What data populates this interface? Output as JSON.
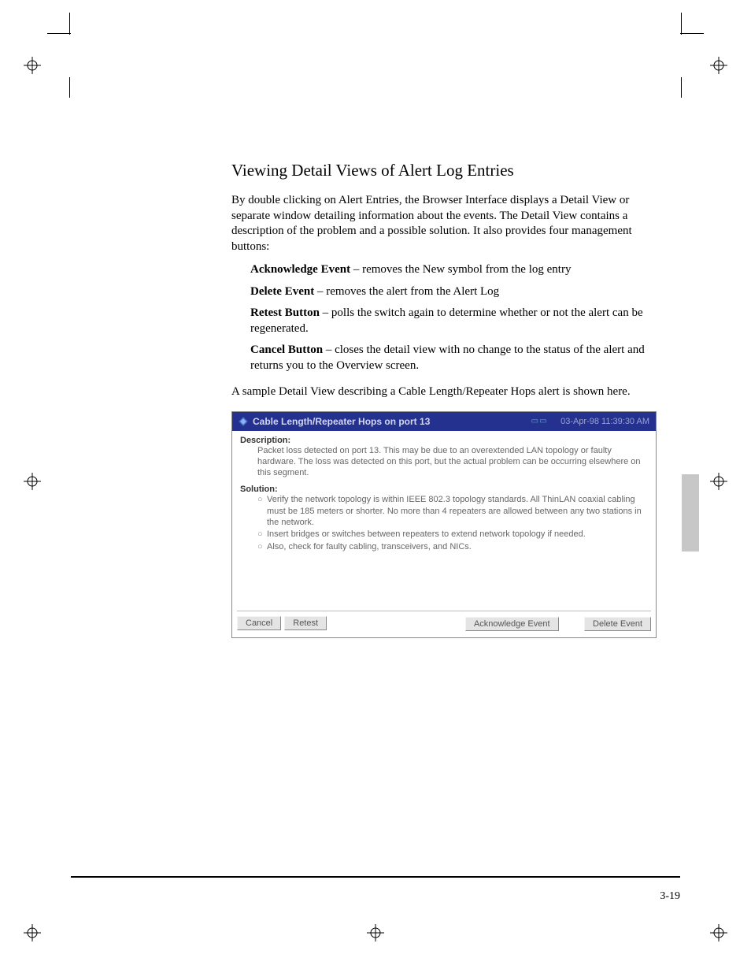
{
  "heading": "Viewing Detail Views of Alert Log Entries",
  "intro": "By double clicking on Alert Entries, the Browser Interface displays a Detail View or separate window detailing information about the events. The Detail View contains a description of the problem and a possible solution. It also provides four management buttons:",
  "buttons_desc": [
    {
      "label": "Acknowledge Event",
      "text": " – removes the New symbol from the log entry"
    },
    {
      "label": "Delete Event",
      "text": " – removes the alert from the Alert Log"
    },
    {
      "label": "Retest Button",
      "text": " – polls the switch again to determine whether or not the alert can be regenerated."
    },
    {
      "label": "Cancel Button",
      "text": " – closes the detail view with no change to the status of the alert and returns you to the Overview screen."
    }
  ],
  "sample_text": "A sample Detail View describing a Cable Length/Repeater Hops alert is shown here.",
  "detail": {
    "title": "Cable Length/Repeater Hops on port 13",
    "timestamp": "03-Apr-98 11:39:30 AM",
    "desc_label": "Description:",
    "description": "Packet loss detected on port 13. This may be due to an overextended LAN topology or faulty hardware. The loss was detected on this port, but the actual problem can be occurring elsewhere on this segment.",
    "sol_label": "Solution:",
    "solutions": [
      "Verify the network topology is within IEEE 802.3 topology standards. All ThinLAN coaxial cabling must be 185 meters or shorter. No more than 4 repeaters are allowed between any two stations in the network.",
      "Insert bridges or switches between repeaters to extend network topology if needed.",
      "Also, check for faulty cabling, transceivers, and NICs."
    ],
    "btn_cancel": "Cancel",
    "btn_retest": "Retest",
    "btn_ack": "Acknowledge Event",
    "btn_delete": "Delete Event"
  },
  "page_number": "3-19"
}
